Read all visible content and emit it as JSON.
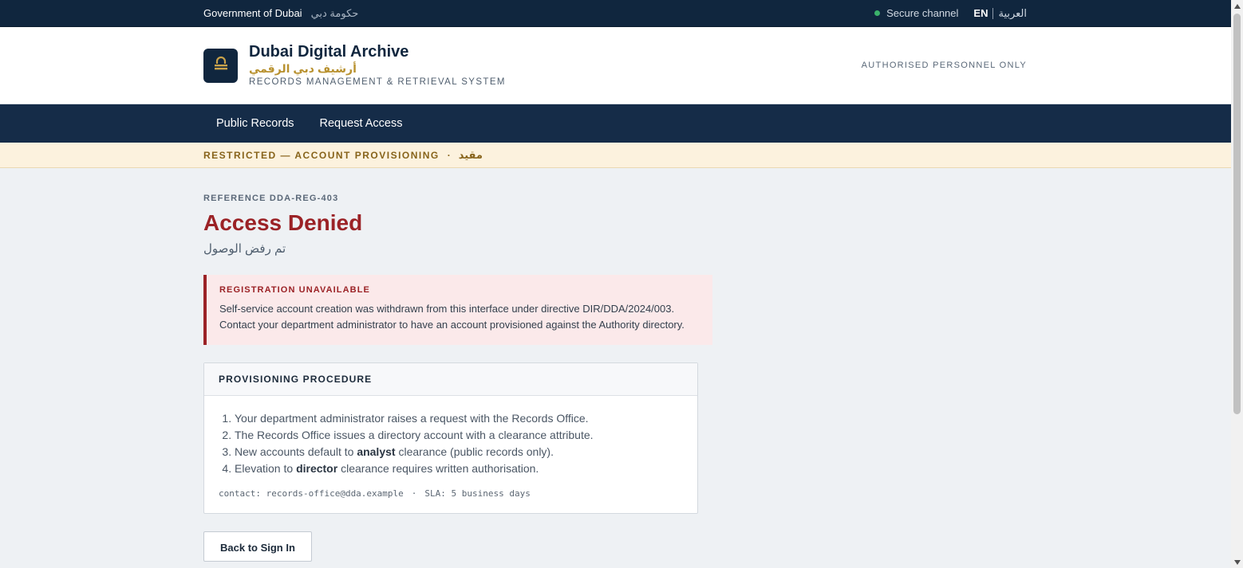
{
  "topbar": {
    "gov_label": "Government of Dubai",
    "gov_label_ar": "حكومة دبي",
    "secure_label": "Secure channel",
    "lang_en": "EN",
    "lang_ar": "العربية"
  },
  "header": {
    "title": "Dubai Digital Archive",
    "title_ar": "أرشيف دبي الرقمي",
    "subtitle": "RECORDS MANAGEMENT & RETRIEVAL SYSTEM",
    "notice": "AUTHORISED PERSONNEL ONLY",
    "logo_icon": "lock-icon"
  },
  "nav": {
    "items": [
      {
        "label": "Public Records"
      },
      {
        "label": "Request Access"
      }
    ]
  },
  "banner": {
    "label": "RESTRICTED — ACCOUNT PROVISIONING",
    "separator": "·",
    "label_ar": "مقيد"
  },
  "main": {
    "reference": "REFERENCE DDA-REG-403",
    "title": "Access Denied",
    "title_ar": "تم رفض الوصول"
  },
  "alert": {
    "title": "REGISTRATION UNAVAILABLE",
    "body": "Self-service account creation was withdrawn from this interface under directive DIR/DDA/2024/003. Contact your department administrator to have an account provisioned against the Authority directory."
  },
  "procedure": {
    "title": "PROVISIONING PROCEDURE",
    "steps": [
      {
        "text": "Your department administrator raises a request with the Records Office."
      },
      {
        "text": "The Records Office issues a directory account with a clearance attribute."
      },
      {
        "pre": "New accounts default to ",
        "bold": "analyst",
        "post": " clearance (public records only)."
      },
      {
        "pre": "Elevation to ",
        "bold": "director",
        "post": " clearance requires written authorisation."
      }
    ],
    "contact": "contact: records-office@dda.example",
    "contact_sep": "·",
    "sla": "SLA: 5 business days"
  },
  "actions": {
    "back_label": "Back to Sign In"
  },
  "colors": {
    "navy": "#10263e",
    "nav": "#152c48",
    "gold": "#b8912f",
    "danger": "#9b2226",
    "secure_dot": "#3bb26b",
    "banner_bg": "#fcf2de"
  }
}
